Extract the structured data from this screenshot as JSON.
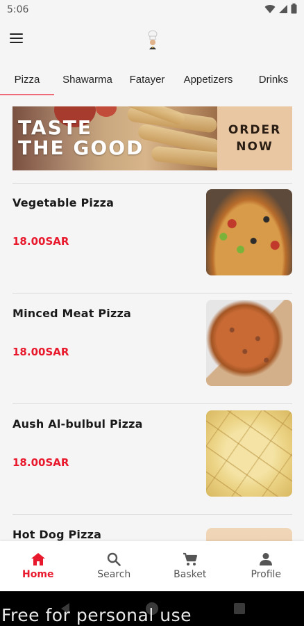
{
  "status_bar": {
    "time": "5:06"
  },
  "app_bar": {
    "menu_icon": "hamburger-menu-icon",
    "logo_icon": "chef-logo-icon"
  },
  "tabs": [
    {
      "label": "Pizza",
      "active": true
    },
    {
      "label": "Shawarma",
      "active": false
    },
    {
      "label": "Fatayer",
      "active": false
    },
    {
      "label": "Appetizers",
      "active": false
    },
    {
      "label": "Drinks",
      "active": false
    }
  ],
  "banner": {
    "title_line1": "TASTE",
    "title_line2": "THE GOOD",
    "cta_line1": "ORDER",
    "cta_line2": "NOW"
  },
  "products": [
    {
      "name": "Vegetable Pizza",
      "price": "18.00SAR"
    },
    {
      "name": "Minced Meat Pizza",
      "price": "18.00SAR"
    },
    {
      "name": "Aush Al-bulbul Pizza",
      "price": "18.00SAR"
    },
    {
      "name": "Hot Dog Pizza",
      "price": ""
    }
  ],
  "bottom_nav": [
    {
      "label": "Home",
      "icon": "home-icon",
      "active": true
    },
    {
      "label": "Search",
      "icon": "search-icon",
      "active": false
    },
    {
      "label": "Basket",
      "icon": "cart-icon",
      "active": false
    },
    {
      "label": "Profile",
      "icon": "person-icon",
      "active": false
    }
  ],
  "watermark": "Free for personal use",
  "colors": {
    "accent": "#e8192c",
    "tab_indicator": "#f06b7a",
    "banner_cta_bg": "#e9c7a3"
  }
}
